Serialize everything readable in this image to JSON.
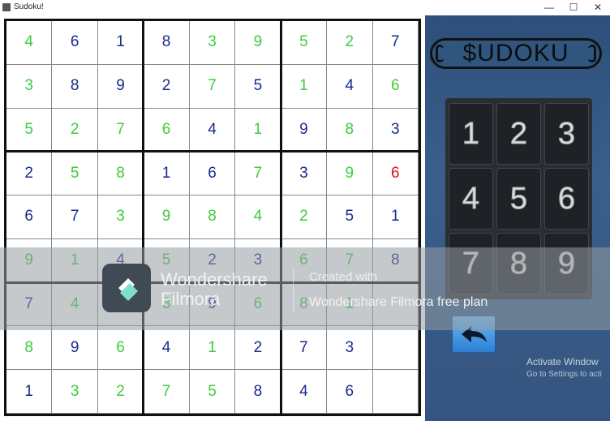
{
  "window": {
    "title": "Sudoku!",
    "minimize": "—",
    "maximize": "☐",
    "close": "✕"
  },
  "board": {
    "rows": [
      [
        {
          "v": "4",
          "s": "user"
        },
        {
          "v": "6",
          "s": "given"
        },
        {
          "v": "1",
          "s": "given"
        },
        {
          "v": "8",
          "s": "given"
        },
        {
          "v": "3",
          "s": "user"
        },
        {
          "v": "9",
          "s": "user"
        },
        {
          "v": "5",
          "s": "user"
        },
        {
          "v": "2",
          "s": "user"
        },
        {
          "v": "7",
          "s": "given"
        }
      ],
      [
        {
          "v": "3",
          "s": "user"
        },
        {
          "v": "8",
          "s": "given"
        },
        {
          "v": "9",
          "s": "given"
        },
        {
          "v": "2",
          "s": "given"
        },
        {
          "v": "7",
          "s": "user"
        },
        {
          "v": "5",
          "s": "given"
        },
        {
          "v": "1",
          "s": "user"
        },
        {
          "v": "4",
          "s": "given"
        },
        {
          "v": "6",
          "s": "user"
        }
      ],
      [
        {
          "v": "5",
          "s": "user"
        },
        {
          "v": "2",
          "s": "user"
        },
        {
          "v": "7",
          "s": "user"
        },
        {
          "v": "6",
          "s": "user"
        },
        {
          "v": "4",
          "s": "given"
        },
        {
          "v": "1",
          "s": "user"
        },
        {
          "v": "9",
          "s": "given"
        },
        {
          "v": "8",
          "s": "user"
        },
        {
          "v": "3",
          "s": "given"
        }
      ],
      [
        {
          "v": "2",
          "s": "given"
        },
        {
          "v": "5",
          "s": "user"
        },
        {
          "v": "8",
          "s": "user"
        },
        {
          "v": "1",
          "s": "given"
        },
        {
          "v": "6",
          "s": "given"
        },
        {
          "v": "7",
          "s": "user"
        },
        {
          "v": "3",
          "s": "given"
        },
        {
          "v": "9",
          "s": "user"
        },
        {
          "v": "6",
          "s": "error"
        }
      ],
      [
        {
          "v": "6",
          "s": "given"
        },
        {
          "v": "7",
          "s": "given"
        },
        {
          "v": "3",
          "s": "user"
        },
        {
          "v": "9",
          "s": "user"
        },
        {
          "v": "8",
          "s": "user"
        },
        {
          "v": "4",
          "s": "user"
        },
        {
          "v": "2",
          "s": "user"
        },
        {
          "v": "5",
          "s": "given"
        },
        {
          "v": "1",
          "s": "given"
        }
      ],
      [
        {
          "v": "9",
          "s": "user"
        },
        {
          "v": "1",
          "s": "user"
        },
        {
          "v": "4",
          "s": "given"
        },
        {
          "v": "5",
          "s": "user"
        },
        {
          "v": "2",
          "s": "given"
        },
        {
          "v": "3",
          "s": "given"
        },
        {
          "v": "6",
          "s": "user"
        },
        {
          "v": "7",
          "s": "user"
        },
        {
          "v": "8",
          "s": "given"
        }
      ],
      [
        {
          "v": "7",
          "s": "given"
        },
        {
          "v": "4",
          "s": "user"
        },
        {
          "v": "5",
          "s": "given"
        },
        {
          "v": "3",
          "s": "user"
        },
        {
          "v": "9",
          "s": "given"
        },
        {
          "v": "6",
          "s": "user"
        },
        {
          "v": "8",
          "s": "user"
        },
        {
          "v": "1",
          "s": "user"
        },
        {
          "v": "",
          "s": "given"
        }
      ],
      [
        {
          "v": "8",
          "s": "user"
        },
        {
          "v": "9",
          "s": "given"
        },
        {
          "v": "6",
          "s": "user"
        },
        {
          "v": "4",
          "s": "given"
        },
        {
          "v": "1",
          "s": "user"
        },
        {
          "v": "2",
          "s": "given"
        },
        {
          "v": "7",
          "s": "given"
        },
        {
          "v": "3",
          "s": "given"
        },
        {
          "v": "",
          "s": "given"
        }
      ],
      [
        {
          "v": "1",
          "s": "given"
        },
        {
          "v": "3",
          "s": "user"
        },
        {
          "v": "2",
          "s": "user"
        },
        {
          "v": "7",
          "s": "user"
        },
        {
          "v": "5",
          "s": "user"
        },
        {
          "v": "8",
          "s": "given"
        },
        {
          "v": "4",
          "s": "given"
        },
        {
          "v": "6",
          "s": "given"
        },
        {
          "v": "",
          "s": "given"
        }
      ]
    ]
  },
  "panel": {
    "logo": "$UDOKU",
    "keys": [
      "1",
      "2",
      "3",
      "4",
      "5",
      "6",
      "7",
      "8",
      "9"
    ],
    "back_icon": "undo-arrow-icon",
    "activate_title": "Activate Window",
    "activate_sub": "Go to Settings to acti"
  },
  "watermark": {
    "brand_line1": "Wondershare",
    "brand_line2": "Filmora",
    "created_with": "Created with",
    "plan": "Wondershare Filmora free plan"
  },
  "colors": {
    "given": "#1a2b8c",
    "user": "#3fcc3f",
    "error": "#dd1111",
    "panel": "#34557f"
  }
}
